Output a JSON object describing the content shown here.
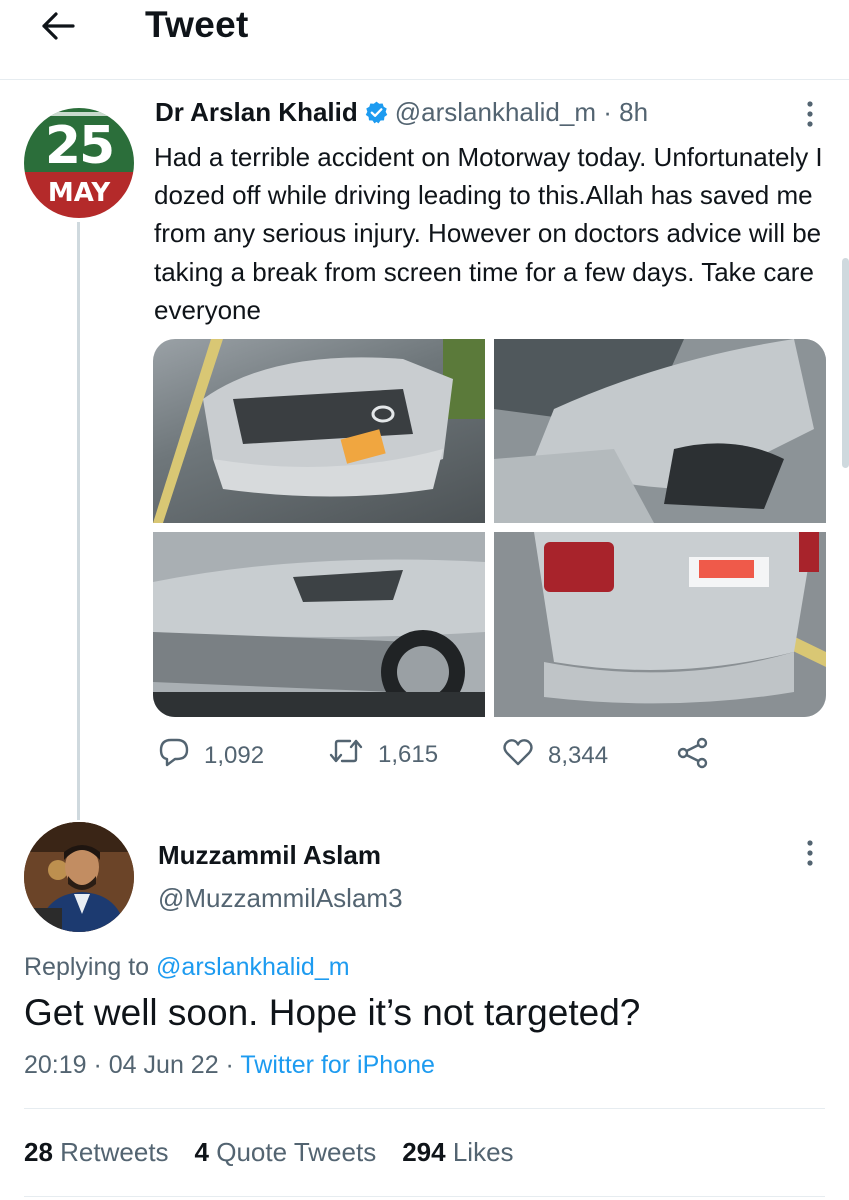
{
  "header": {
    "title": "Tweet",
    "back_icon": "arrow-left-icon"
  },
  "original_tweet": {
    "author_name": "Dr Arslan Khalid",
    "verified_icon": "verified-badge-icon",
    "handle": "@arslankhalid_m",
    "separator": " · ",
    "time": "8h",
    "avatar": {
      "date_number": "25",
      "month": "MAY"
    },
    "text": "Had a terrible accident on Motorway today. Unfortunately I dozed off while driving leading to this.Allah has saved me from any serious injury. However on doctors advice will be taking a break from screen time for a few days. Take care everyone",
    "photo_count": 4,
    "actions": {
      "replies": "1,092",
      "retweets": "1,615",
      "likes": "8,344"
    }
  },
  "reply_tweet": {
    "author_name": "Muzzammil Aslam",
    "handle": "@MuzzammilAslam3",
    "replying_prefix": "Replying to ",
    "replying_to": "@arslankhalid_m",
    "text": "Get well soon. Hope it’s not targeted?",
    "time": "20:19",
    "date": "04 Jun 22",
    "dot": " · ",
    "source": "Twitter for iPhone",
    "stats": [
      {
        "count": "28",
        "label": "Retweets"
      },
      {
        "count": "4",
        "label": "Quote Tweets"
      },
      {
        "count": "294",
        "label": "Likes"
      }
    ]
  },
  "colors": {
    "text_primary": "#0f1419",
    "text_secondary": "#536471",
    "accent_blue": "#1d9bf0",
    "divider": "#e6ecf0"
  }
}
